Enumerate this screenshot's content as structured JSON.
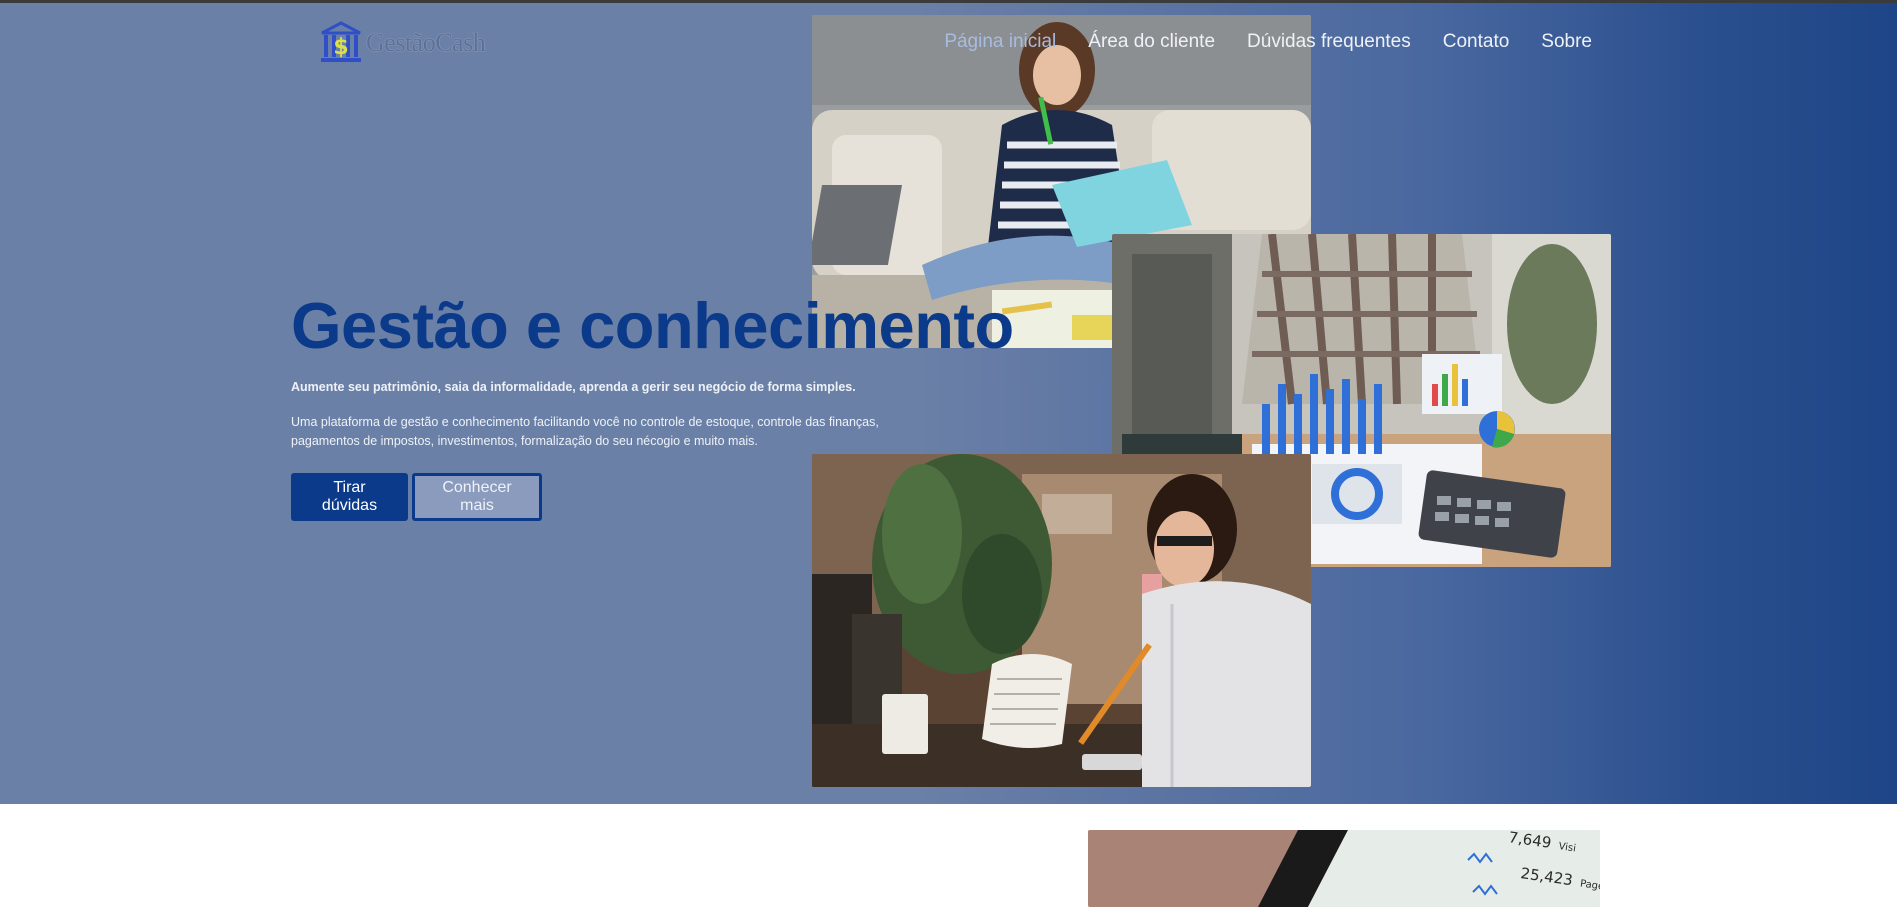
{
  "brand": {
    "logo_text": "GestãoCash",
    "logo_icon": "bank-dollar-icon"
  },
  "nav": {
    "items": [
      {
        "label": "Página inicial",
        "active": true
      },
      {
        "label": "Área do cliente",
        "active": false
      },
      {
        "label": "Dúvidas frequentes",
        "active": false
      },
      {
        "label": "Contato",
        "active": false
      },
      {
        "label": "Sobre",
        "active": false
      }
    ]
  },
  "hero": {
    "title": "Gestão e conhecimento",
    "subtitle": "Aumente seu patrimônio, saia da informalidade, aprenda a gerir seu negócio de forma simples.",
    "description": "Uma plataforma de gestão e conhecimento facilitando você no controle de estoque, controle das finanças, pagamentos de impostos, investimentos, formalização do seu nécogio e muito mais.",
    "buttons": {
      "primary": "Tirar dúvidas",
      "secondary": "Conhecer mais"
    }
  },
  "dashboard_photo": {
    "stat_1": "7,649",
    "stat_1_label": "Visi",
    "stat_2": "25,423",
    "stat_2_label": "Pagevi"
  },
  "colors": {
    "primary": "#0b3a8a",
    "hero_bg": "#6b80a7",
    "hero_bg_end": "#1e4587",
    "nav_active": "#a8bce0",
    "text_light": "#eef1f7"
  }
}
